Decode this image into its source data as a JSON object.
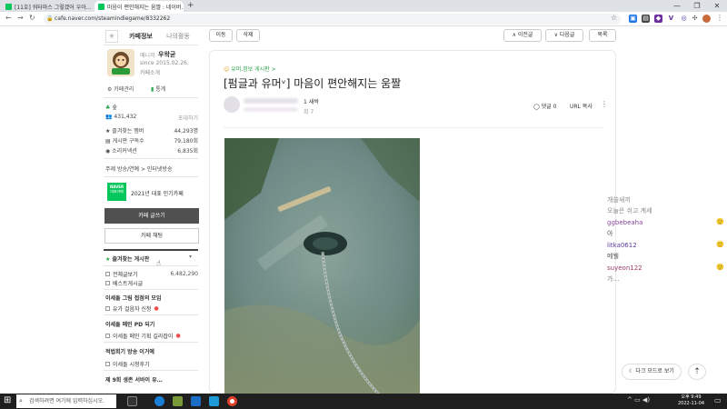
{
  "browser": {
    "tabs": [
      {
        "label": "[11호] 워터마스 그렇겠어 우아…",
        "active": false
      },
      {
        "label": "마음이 편안해지는 움짤 : 네이버…",
        "active": true
      }
    ],
    "new_tab": "+",
    "url": "cafe.naver.com/steamindiegame/8332262",
    "window_controls": [
      "—",
      "❐",
      "✕"
    ]
  },
  "cafe": {
    "tabs": [
      "카페정보",
      "나의활동"
    ],
    "manager_label": "매니저",
    "manager_name": "우왁굳",
    "since": "since 2015.02.26.",
    "since_extra": "카페소개",
    "admin_link": "⚙ 카페관리",
    "stats_link": "통계",
    "level": "숲",
    "members": "431,432",
    "invite": "초대하기",
    "stats": [
      {
        "label": "즐겨찾는 멤버",
        "value": "44,293명"
      },
      {
        "label": "게시판 구독수",
        "value": "79,180회"
      },
      {
        "label": "소리커넥션",
        "value": "6,835회"
      }
    ],
    "topic": "주제 방송/연예 > 인터넷방송",
    "badge_line1": "NAVER",
    "badge_line2": "대표카페",
    "badge_text": "2021년 대표 인기카페",
    "write_button": "카페 글쓰기",
    "chat_button": "카페 채팅",
    "fav_board": "즐겨찾는 게시판",
    "menu": [
      {
        "type": "item",
        "label": "전체글보기",
        "count": "6,482,290"
      },
      {
        "type": "item",
        "label": "베스트게시글",
        "count": ""
      },
      {
        "type": "title",
        "label": "이세돌 그림 접점의 모임"
      },
      {
        "type": "item",
        "label": "유가 걸음자 신청",
        "count": ""
      },
      {
        "type": "title",
        "label": "이세돌 메인 PD 되기"
      },
      {
        "type": "item",
        "label": "이세돌 메인 기획 길라잡이",
        "count": ""
      },
      {
        "type": "title",
        "label": "적법회기 방송 이거예"
      },
      {
        "type": "item",
        "label": "이세돌 시청후기",
        "count": ""
      },
      {
        "type": "title",
        "label": "제 9회 생존 서바이 유…"
      }
    ]
  },
  "article": {
    "toolbar": {
      "move": "이동",
      "delete": "삭제",
      "prev": "∧ 이전글",
      "next": "∨ 다음글",
      "list": "목록"
    },
    "board": "유머,정보 게시판 >",
    "title": "[펌글과 유머ᵛ] 마음이 편안해지는 움짤",
    "author_level": "1 새싹",
    "author_meta": "회 7",
    "comments": "댓글 0",
    "url_copy": "URL 복사",
    "more": "⋮"
  },
  "chat": [
    {
      "user": "",
      "msg": "개쓸새끼",
      "user_color": "#8a8a8a"
    },
    {
      "user": "",
      "msg": "오늘은 쉬고 계세",
      "user_color": "#8a8a8a"
    },
    {
      "user": "ggbebeaha",
      "msg": "아",
      "user_color": "#8b4ba0"
    },
    {
      "user": "litka0612",
      "msg": "메웰",
      "user_color": "#5a3a9a"
    },
    {
      "user": "suyeon122",
      "msg": "가…",
      "user_color": "#9a3a6a"
    }
  ],
  "floating": {
    "dark_mode": "다크 모드로 보기",
    "scroll_top": "⇡"
  },
  "taskbar": {
    "search_placeholder": "검색하려면 여기에 입력하십시오.",
    "time": "오후 9:49",
    "date": "2022-11-04"
  },
  "colors": {
    "naver_green": "#03c75a",
    "fav_star": "#2aa34a",
    "taskbar": "#1f1f1f"
  }
}
